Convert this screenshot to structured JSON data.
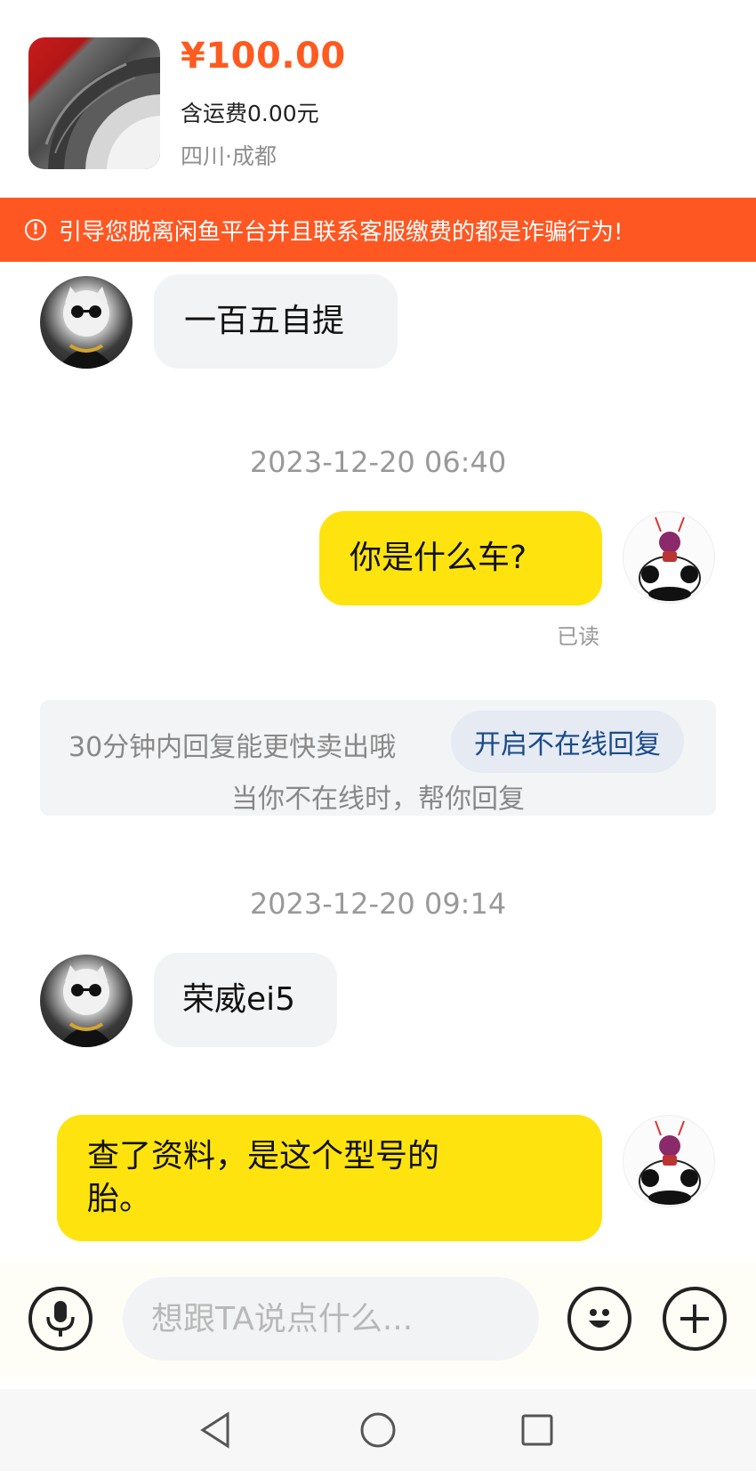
{
  "product": {
    "price": "¥100.00",
    "shipping": "含运费0.00元",
    "location": "四川·成都"
  },
  "warning": {
    "icon": "exclamation-circle-icon",
    "text": "引导您脱离闲鱼平台并且联系客服缴费的都是诈骗行为!"
  },
  "messages": [
    {
      "side": "in",
      "text": "一百五自提"
    },
    {
      "timestamp": "2023-12-20 06:40"
    },
    {
      "side": "out",
      "text": "你是什么车?",
      "status": "已读"
    },
    {
      "timestamp": "2023-12-20 09:14"
    },
    {
      "side": "in",
      "text": "荣威ei5"
    },
    {
      "side": "out",
      "text_line1": "查了资料，是这个型号的",
      "text_line2": "胎。"
    }
  ],
  "tip": {
    "text": "30分钟内回复能更快卖出哦",
    "button": "开启不在线回复",
    "subtext": "当你不在线时，帮你回复"
  },
  "input": {
    "placeholder": "想跟TA说点什么..."
  },
  "colors": {
    "accent": "#ff5a1f",
    "warning_bg": "#ff5722",
    "outgoing_bubble": "#ffe30f",
    "incoming_bubble": "#f2f3f5"
  }
}
